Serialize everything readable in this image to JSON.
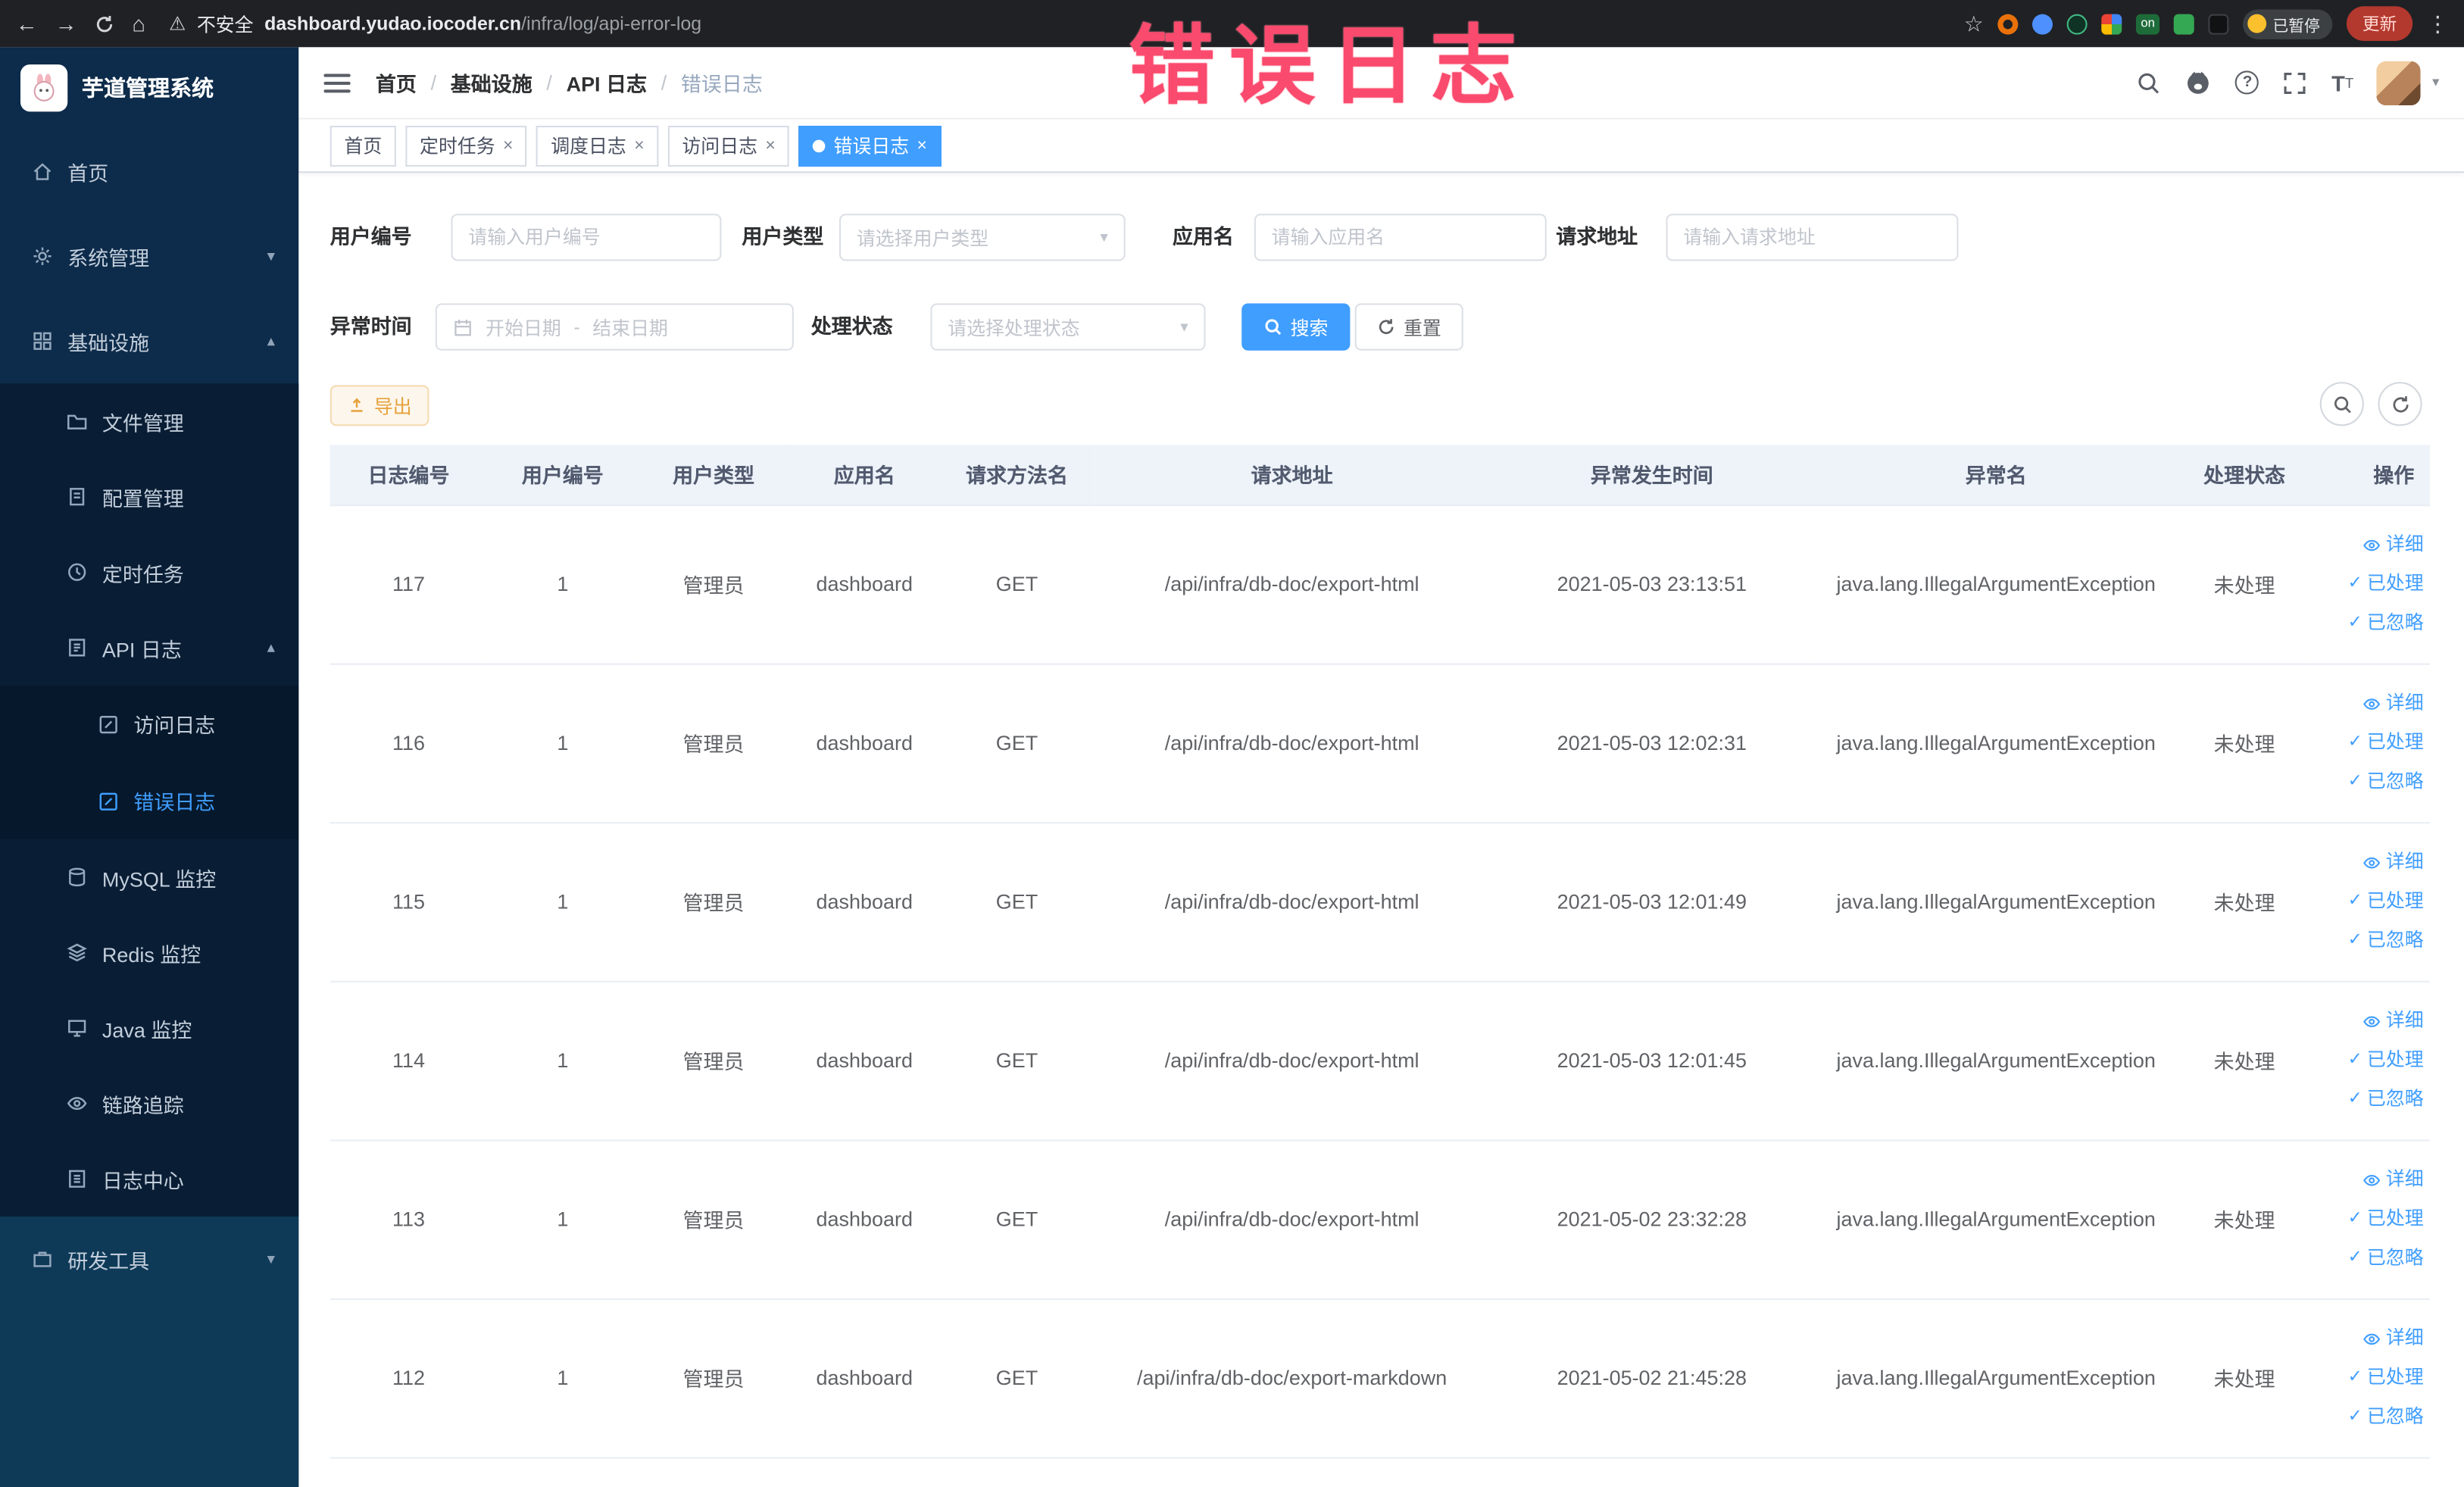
{
  "annotation": {
    "overlay_text": "错误日志"
  },
  "colors": {
    "accent": "#409eff",
    "warning_button": "#e6a23c",
    "annotation_text": "#fa4a6d",
    "sidebar_bg": "#0d2b4a",
    "chrome_bg": "#202124"
  },
  "icons": {
    "back": "←",
    "forward": "→",
    "home": "⌂",
    "warning": "⚠",
    "bookmark_star": "☆",
    "menu_dots": "⋮",
    "chevron_down": "▾",
    "chevron_up": "▴",
    "close": "×",
    "check": "✓",
    "question_mark": "?",
    "font_large": "T",
    "font_small": "T",
    "avatar_caret": "▾"
  },
  "browser": {
    "security_label": "不安全",
    "url_host": "dashboard.yudao.iocoder.cn",
    "url_path": "/infra/log/api-error-log",
    "extension_on_badge": "on",
    "paused_badge": "已暂停",
    "update_button": "更新"
  },
  "sidebar": {
    "app_title": "芋道管理系统",
    "items": [
      {
        "label": "首页"
      },
      {
        "label": "系统管理"
      },
      {
        "label": "基础设施"
      },
      {
        "label": "文件管理"
      },
      {
        "label": "配置管理"
      },
      {
        "label": "定时任务"
      },
      {
        "label": "API 日志"
      },
      {
        "label": "访问日志"
      },
      {
        "label": "错误日志"
      },
      {
        "label": "MySQL 监控"
      },
      {
        "label": "Redis 监控"
      },
      {
        "label": "Java 监控"
      },
      {
        "label": "链路追踪"
      },
      {
        "label": "日志中心"
      },
      {
        "label": "研发工具"
      }
    ]
  },
  "header": {
    "separator": "/",
    "breadcrumb": [
      {
        "label": "首页"
      },
      {
        "label": "基础设施"
      },
      {
        "label": "API 日志"
      },
      {
        "label": "错误日志"
      }
    ]
  },
  "tabs": [
    {
      "label": "首页"
    },
    {
      "label": "定时任务"
    },
    {
      "label": "调度日志"
    },
    {
      "label": "访问日志"
    },
    {
      "label": "错误日志"
    }
  ],
  "filters": {
    "user_id_label": "用户编号",
    "user_id_placeholder": "请输入用户编号",
    "user_type_label": "用户类型",
    "user_type_placeholder": "请选择用户类型",
    "app_name_label": "应用名",
    "app_name_placeholder": "请输入应用名",
    "request_url_label": "请求地址",
    "request_url_placeholder": "请输入请求地址",
    "exception_time_label": "异常时间",
    "start_date_placeholder": "开始日期",
    "range_separator": "-",
    "end_date_placeholder": "结束日期",
    "process_status_label": "处理状态",
    "process_status_placeholder": "请选择处理状态",
    "search_button": "搜索",
    "reset_button": "重置"
  },
  "toolbar": {
    "export_button": "导出"
  },
  "table": {
    "columns": [
      "日志编号",
      "用户编号",
      "用户类型",
      "应用名",
      "请求方法名",
      "请求地址",
      "异常发生时间",
      "异常名",
      "处理状态",
      "操作"
    ],
    "action_labels": {
      "detail": "详细",
      "processed": "已处理",
      "ignored": "已忽略"
    },
    "rows": [
      {
        "id": "117",
        "user_id": "1",
        "user_type": "管理员",
        "app": "dashboard",
        "method": "GET",
        "url": "/api/infra/db-doc/export-html",
        "time": "2021-05-03 23:13:51",
        "exception": "java.lang.IllegalArgumentException",
        "status": "未处理"
      },
      {
        "id": "116",
        "user_id": "1",
        "user_type": "管理员",
        "app": "dashboard",
        "method": "GET",
        "url": "/api/infra/db-doc/export-html",
        "time": "2021-05-03 12:02:31",
        "exception": "java.lang.IllegalArgumentException",
        "status": "未处理"
      },
      {
        "id": "115",
        "user_id": "1",
        "user_type": "管理员",
        "app": "dashboard",
        "method": "GET",
        "url": "/api/infra/db-doc/export-html",
        "time": "2021-05-03 12:01:49",
        "exception": "java.lang.IllegalArgumentException",
        "status": "未处理"
      },
      {
        "id": "114",
        "user_id": "1",
        "user_type": "管理员",
        "app": "dashboard",
        "method": "GET",
        "url": "/api/infra/db-doc/export-html",
        "time": "2021-05-03 12:01:45",
        "exception": "java.lang.IllegalArgumentException",
        "status": "未处理"
      },
      {
        "id": "113",
        "user_id": "1",
        "user_type": "管理员",
        "app": "dashboard",
        "method": "GET",
        "url": "/api/infra/db-doc/export-html",
        "time": "2021-05-02 23:32:28",
        "exception": "java.lang.IllegalArgumentException",
        "status": "未处理"
      },
      {
        "id": "112",
        "user_id": "1",
        "user_type": "管理员",
        "app": "dashboard",
        "method": "GET",
        "url": "/api/infra/db-doc/export-markdown",
        "time": "2021-05-02 21:45:28",
        "exception": "java.lang.IllegalArgumentException",
        "status": "未处理"
      }
    ]
  }
}
